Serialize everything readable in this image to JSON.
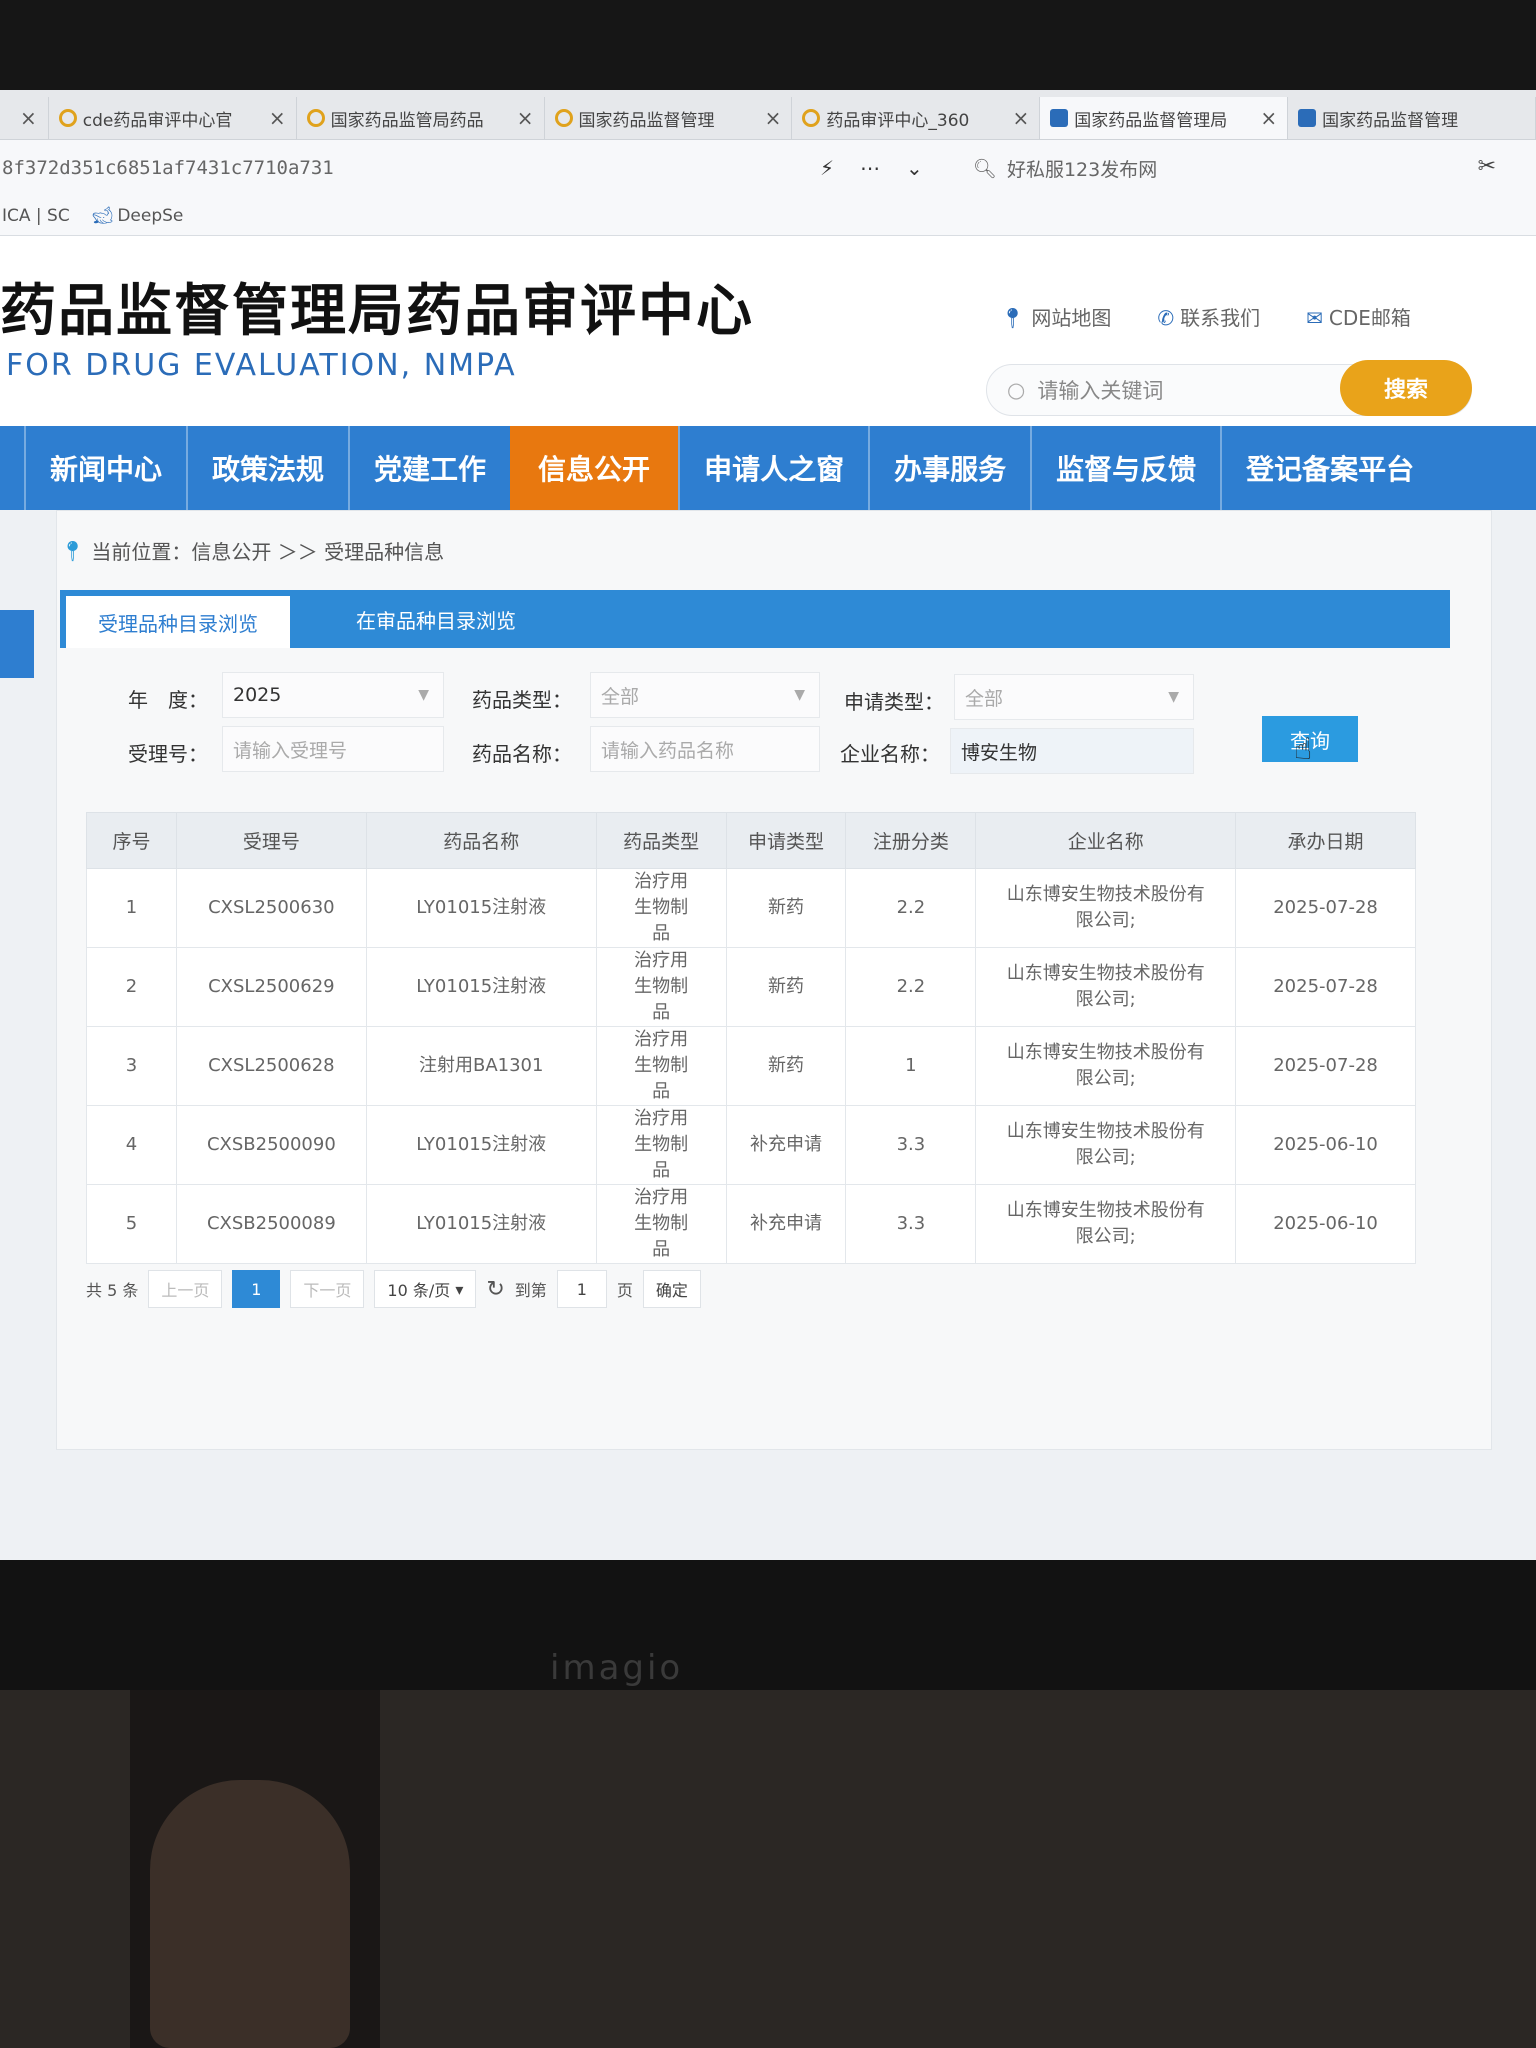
{
  "browser": {
    "tabs": [
      {
        "title": "",
        "icon": "close-icon"
      },
      {
        "title": "cde药品审评中心官",
        "icon": "search-engine-icon"
      },
      {
        "title": "国家药品监管局药品",
        "icon": "search-engine-icon"
      },
      {
        "title": "国家药品监督管理",
        "icon": "search-engine-icon"
      },
      {
        "title": "药品审评中心_360",
        "icon": "search-engine-icon"
      },
      {
        "title": "国家药品监督管理局",
        "icon": "site-icon"
      },
      {
        "title": "国家药品监督管理",
        "icon": "site-icon"
      }
    ],
    "url": "8f372d351c6851af7431c7710a731",
    "search_text": "好私服123发布网",
    "bookmarks": [
      "ICA | SC",
      "DeepSe"
    ]
  },
  "site": {
    "title": "药品监督管理局药品审评中心",
    "subtitle": "FOR DRUG EVALUATION, NMPA",
    "top_links": [
      "网站地图",
      "联系我们",
      "CDE邮箱"
    ],
    "search_placeholder": "请输入关键词",
    "search_button": "搜索",
    "nav": [
      "新闻中心",
      "政策法规",
      "党建工作",
      "信息公开",
      "申请人之窗",
      "办事服务",
      "监督与反馈",
      "登记备案平台"
    ],
    "nav_active": "信息公开",
    "colors": {
      "nav": "#2e7ed0",
      "nav_active": "#e8780f",
      "search_button": "#e9a31a"
    }
  },
  "breadcrumb": {
    "text": "当前位置：信息公开 ＞＞ 受理品种信息"
  },
  "tabs": {
    "active": "受理品种目录浏览",
    "other": "在审品种目录浏览"
  },
  "filters": {
    "year_label": "年　度：",
    "year_value": "2025",
    "drug_type_label": "药品类型：",
    "drug_type_value": "全部",
    "apply_type_label": "申请类型：",
    "apply_type_value": "全部",
    "accept_no_label": "受理号：",
    "accept_no_placeholder": "请输入受理号",
    "drug_name_label": "药品名称：",
    "drug_name_placeholder": "请输入药品名称",
    "company_label": "企业名称：",
    "company_value": "博安生物",
    "query_button": "查询"
  },
  "table": {
    "headers": [
      "序号",
      "受理号",
      "药品名称",
      "药品类型",
      "申请类型",
      "注册分类",
      "企业名称",
      "承办日期"
    ],
    "rows": [
      [
        "1",
        "CXSL2500630",
        "LY01015注射液",
        "治疗用生物制品",
        "新药",
        "2.2",
        "山东博安生物技术股份有限公司;",
        "2025-07-28"
      ],
      [
        "2",
        "CXSL2500629",
        "LY01015注射液",
        "治疗用生物制品",
        "新药",
        "2.2",
        "山东博安生物技术股份有限公司;",
        "2025-07-28"
      ],
      [
        "3",
        "CXSL2500628",
        "注射用BA1301",
        "治疗用生物制品",
        "新药",
        "1",
        "山东博安生物技术股份有限公司;",
        "2025-07-28"
      ],
      [
        "4",
        "CXSB2500090",
        "LY01015注射液",
        "治疗用生物制品",
        "补充申请",
        "3.3",
        "山东博安生物技术股份有限公司;",
        "2025-06-10"
      ],
      [
        "5",
        "CXSB2500089",
        "LY01015注射液",
        "治疗用生物制品",
        "补充申请",
        "3.3",
        "山东博安生物技术股份有限公司;",
        "2025-06-10"
      ]
    ]
  },
  "pager": {
    "total": "共 5 条",
    "prev": "上一页",
    "current_page": "1",
    "next": "下一页",
    "page_size": "10 条/页",
    "goto_label": "到第",
    "goto_value": "1",
    "page_unit": "页",
    "confirm": "确定"
  },
  "monitor": {
    "brand": "imagio"
  }
}
